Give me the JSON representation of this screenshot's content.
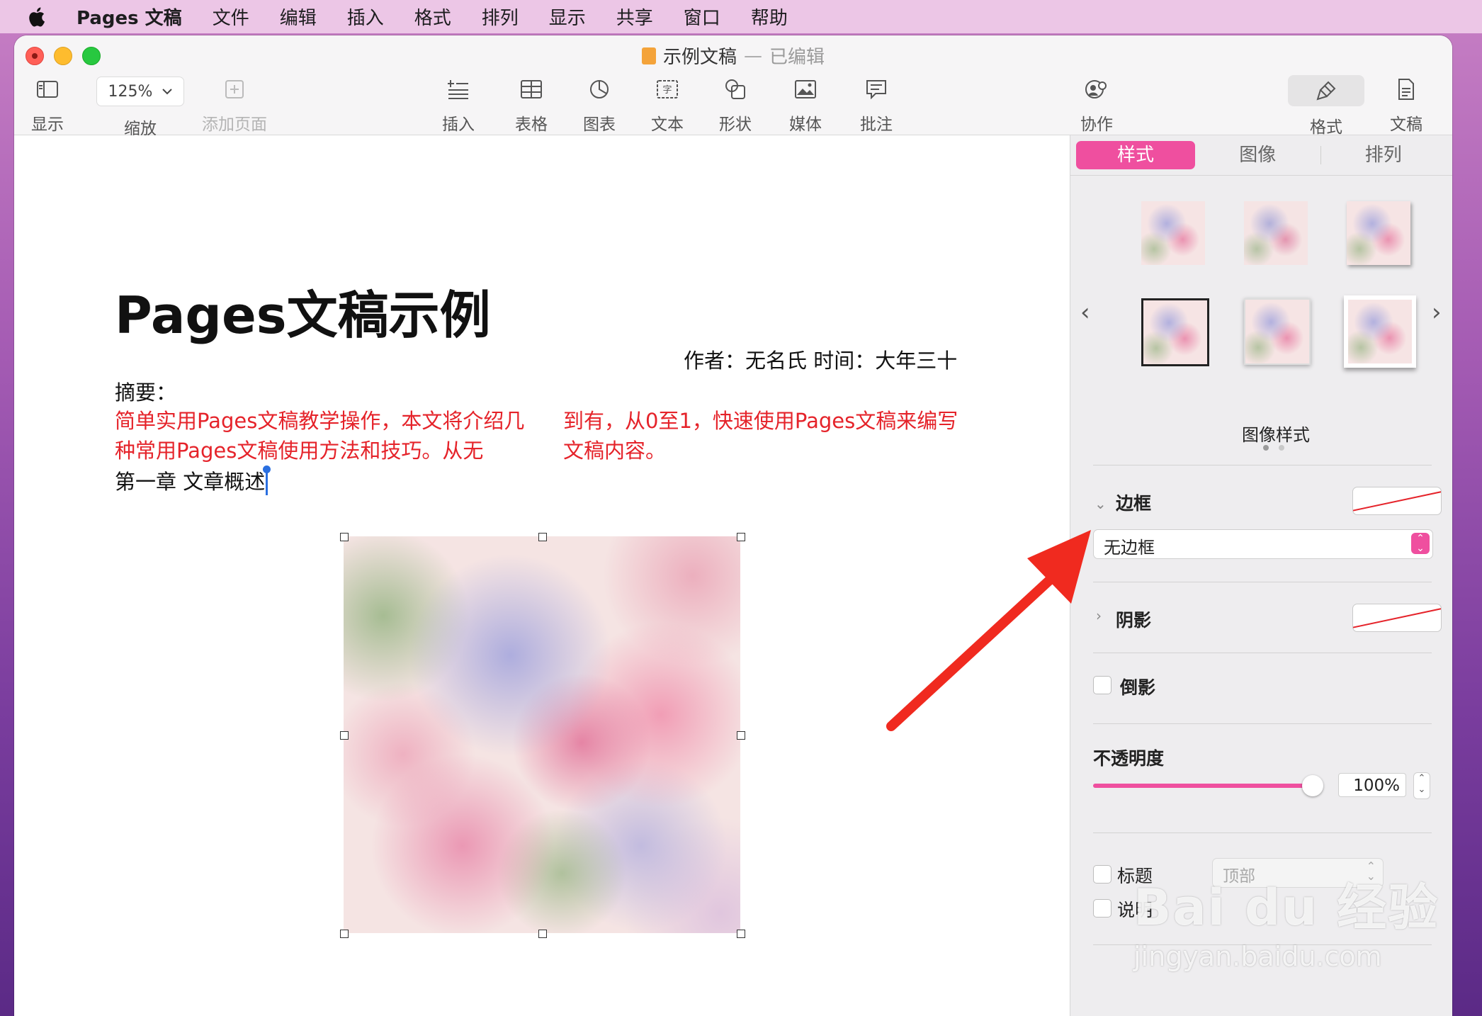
{
  "menubar": {
    "app": "Pages 文稿",
    "items": [
      "文件",
      "编辑",
      "插入",
      "格式",
      "排列",
      "显示",
      "共享",
      "窗口",
      "帮助"
    ]
  },
  "window": {
    "title": "示例文稿",
    "separator": "—",
    "status": "已编辑"
  },
  "toolbar": {
    "view": "显示",
    "zoom_value": "125%",
    "zoom": "缩放",
    "add_page": "添加页面",
    "insert": "插入",
    "table": "表格",
    "chart": "图表",
    "text": "文本",
    "shape": "形状",
    "media": "媒体",
    "comment": "批注",
    "collaborate": "协作",
    "format": "格式",
    "document": "文稿"
  },
  "document": {
    "heading": "Pages文稿示例",
    "author_line": "作者：无名氏 时间：大年三十",
    "summary_label": "摘要：",
    "abstract_col1": "简单实用Pages文稿教学操作，本文将介绍几种常用Pages文稿使用方法和技巧。从无",
    "abstract_col2": "到有，从0至1，快速使用Pages文稿来编写文稿内容。",
    "chapter": "第一章 文章概述"
  },
  "sidebar": {
    "tabs": [
      "样式",
      "图像",
      "排列"
    ],
    "image_styles_label": "图像样式",
    "border_label": "边框",
    "border_value": "无边框",
    "shadow_label": "阴影",
    "reflection_label": "倒影",
    "opacity_label": "不透明度",
    "opacity_value": "100%",
    "opacity_level": 1.0,
    "title_label": "标题",
    "title_position": "顶部",
    "caption_label": "说明"
  },
  "watermark": {
    "line1": "Bai du 经验",
    "line2": "jingyan.baidu.com"
  },
  "colors": {
    "accent": "#ef4f9f",
    "abstract_text": "#e5232a",
    "annotation_arrow": "#f02a1f"
  }
}
